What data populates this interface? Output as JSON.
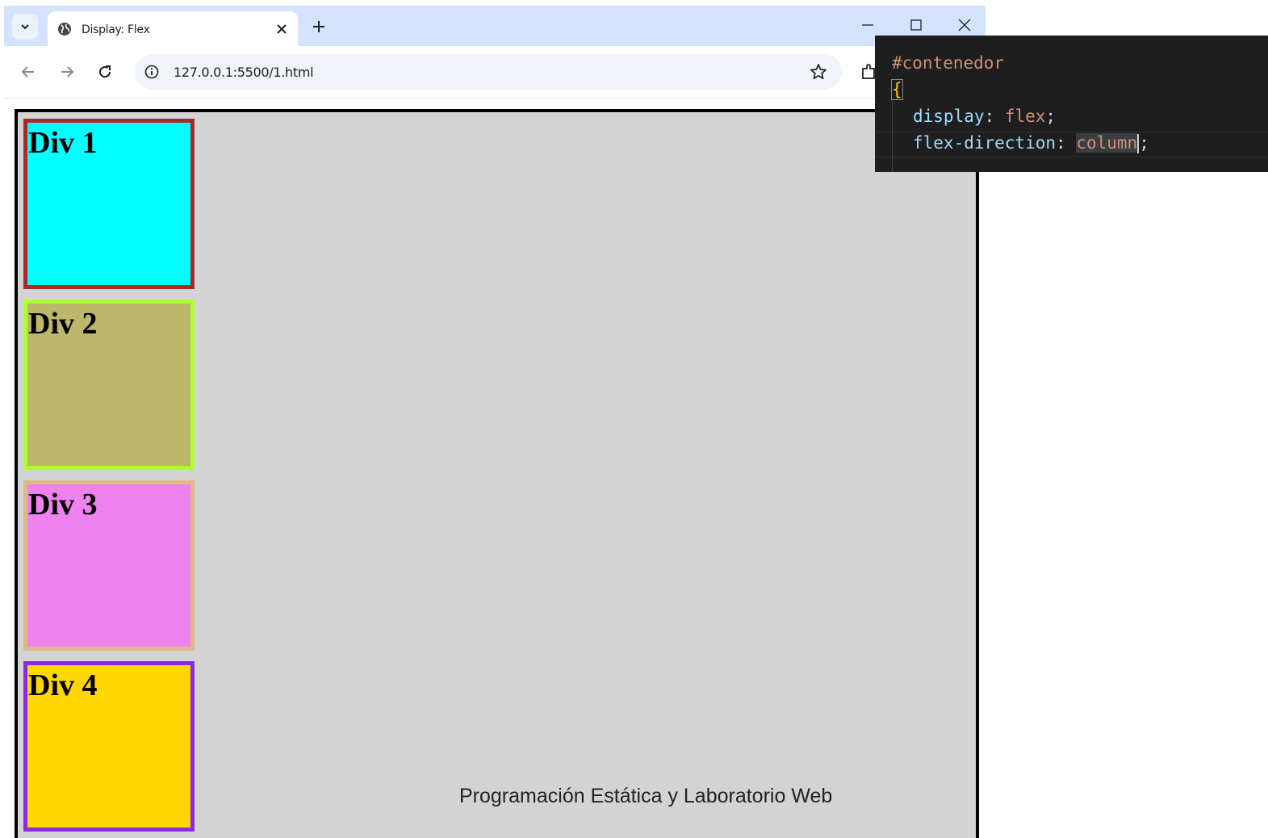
{
  "browser": {
    "tab": {
      "title": "Display: Flex"
    },
    "url": "127.0.0.1:5500/1.html"
  },
  "page": {
    "divs": [
      {
        "label": "Div 1",
        "background": "#00ffff",
        "border": "#a52a2a"
      },
      {
        "label": "Div 2",
        "background": "#bdb76b",
        "border": "#adff2f"
      },
      {
        "label": "Div 3",
        "background": "#ee82ee",
        "border": "#deb887"
      },
      {
        "label": "Div 4",
        "background": "#ffd700",
        "border": "#8a2be2"
      }
    ],
    "container_background": "#d3d3d3",
    "footer": "Programación Estática y Laboratorio Web"
  },
  "editor": {
    "selector": "#contenedor",
    "open_brace": "{",
    "line1_prop": "display",
    "line1_value": "flex",
    "line2_prop": "flex-direction",
    "line2_value": "column",
    "colon": ":",
    "semicolon": ";"
  }
}
